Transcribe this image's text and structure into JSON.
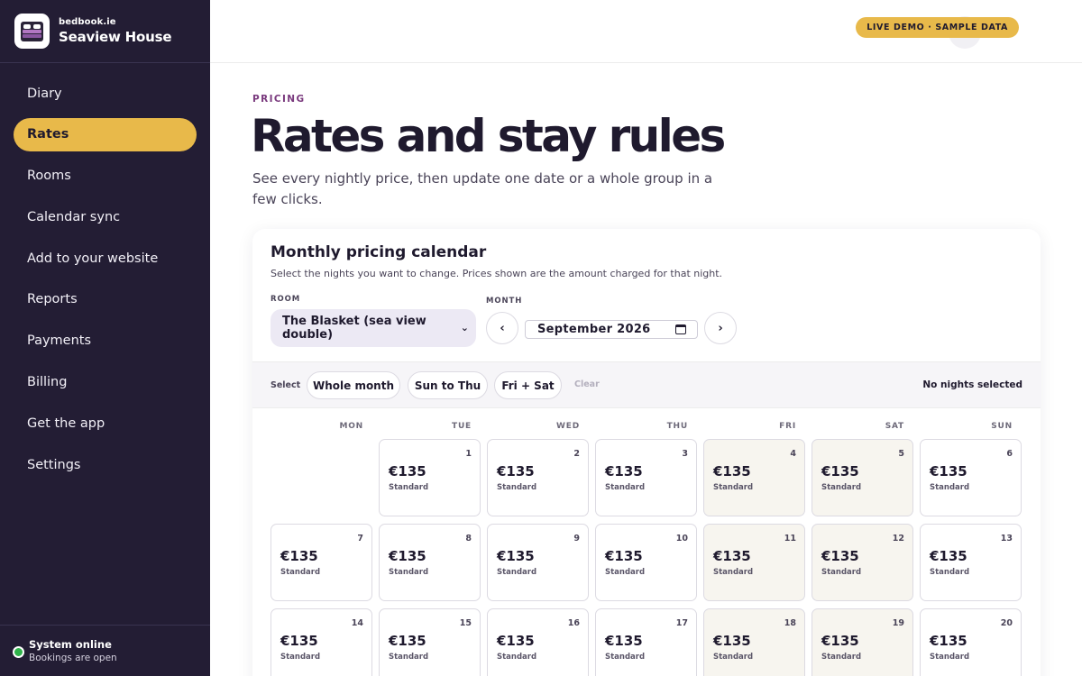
{
  "brand": {
    "domain": "bedbook.ie",
    "name": "Seaview House"
  },
  "nav": [
    {
      "label": "Diary",
      "active": false
    },
    {
      "label": "Rates",
      "active": true
    },
    {
      "label": "Rooms",
      "active": false
    },
    {
      "label": "Calendar sync",
      "active": false
    },
    {
      "label": "Add to your website",
      "active": false
    },
    {
      "label": "Reports",
      "active": false
    },
    {
      "label": "Payments",
      "active": false
    },
    {
      "label": "Billing",
      "active": false
    },
    {
      "label": "Get the app",
      "active": false
    },
    {
      "label": "Settings",
      "active": false
    }
  ],
  "status": {
    "title": "System online",
    "subtitle": "Bookings are open",
    "color": "#2fb34a"
  },
  "topbar": {
    "badge": "LIVE DEMO · SAMPLE DATA"
  },
  "page": {
    "eyebrow": "PRICING",
    "title": "Rates and stay rules",
    "subtitle": "See every nightly price, then update one date or a whole group in a few clicks."
  },
  "calendar": {
    "title": "Monthly pricing calendar",
    "subtitle": "Select the nights you want to change. Prices shown are the amount charged for that night.",
    "room_label": "ROOM",
    "room_value": "The Blasket (sea view double)",
    "month_label": "MONTH",
    "month_value": "September  2026",
    "prev_label": "‹",
    "next_label": "›",
    "select_label": "Select",
    "select_options": [
      "Whole month",
      "Sun to Thu",
      "Fri + Sat"
    ],
    "clear_label": "Clear",
    "nights_selected": "No nights selected",
    "weekdays": [
      "MON",
      "TUE",
      "WED",
      "THU",
      "FRI",
      "SAT",
      "SUN"
    ],
    "days": [
      {
        "day": "1",
        "price": "€135",
        "tier": "Standard"
      },
      {
        "day": "2",
        "price": "€135",
        "tier": "Standard"
      },
      {
        "day": "3",
        "price": "€135",
        "tier": "Standard"
      },
      {
        "day": "4",
        "price": "€135",
        "tier": "Standard"
      },
      {
        "day": "5",
        "price": "€135",
        "tier": "Standard"
      },
      {
        "day": "6",
        "price": "€135",
        "tier": "Standard"
      },
      {
        "day": "7",
        "price": "€135",
        "tier": "Standard"
      },
      {
        "day": "8",
        "price": "€135",
        "tier": "Standard"
      },
      {
        "day": "9",
        "price": "€135",
        "tier": "Standard"
      },
      {
        "day": "10",
        "price": "€135",
        "tier": "Standard"
      },
      {
        "day": "11",
        "price": "€135",
        "tier": "Standard"
      },
      {
        "day": "12",
        "price": "€135",
        "tier": "Standard"
      },
      {
        "day": "13",
        "price": "€135",
        "tier": "Standard"
      },
      {
        "day": "14",
        "price": "€135",
        "tier": "Standard"
      },
      {
        "day": "15",
        "price": "€135",
        "tier": "Standard"
      },
      {
        "day": "16",
        "price": "€135",
        "tier": "Standard"
      },
      {
        "day": "17",
        "price": "€135",
        "tier": "Standard"
      },
      {
        "day": "18",
        "price": "€135",
        "tier": "Standard"
      },
      {
        "day": "19",
        "price": "€135",
        "tier": "Standard"
      },
      {
        "day": "20",
        "price": "€135",
        "tier": "Standard"
      }
    ]
  },
  "colors": {
    "sidebar": "#231d34",
    "accent": "#e8b94a",
    "eyebrow": "#7a3a7e",
    "weekend_cell": "#f7f5ef"
  }
}
